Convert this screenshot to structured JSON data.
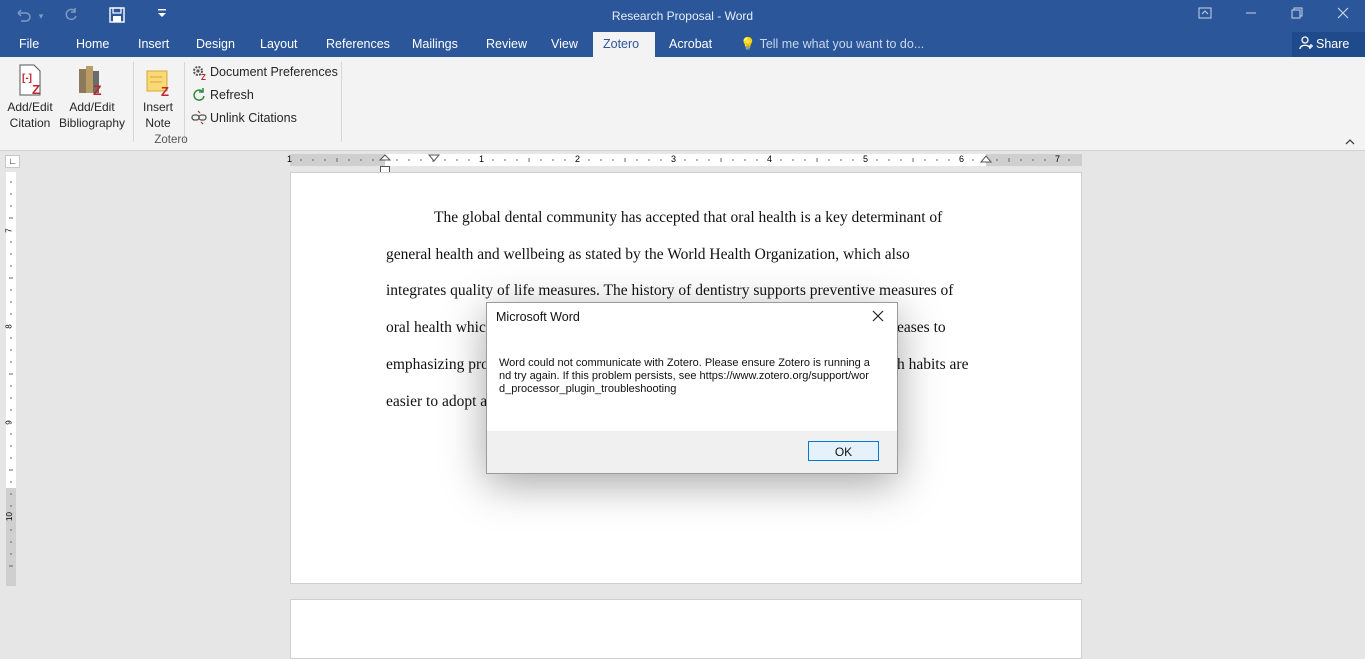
{
  "window": {
    "title": "Research Proposal - Word",
    "qat": {
      "undo_icon": "undo-icon",
      "redo_icon": "redo-icon",
      "save_icon": "save-icon",
      "customize_icon": "customize-qat-icon"
    },
    "controls": {
      "ribbon_display": "ribbon-display-icon",
      "minimize": "minimize-icon",
      "restore": "restore-icon",
      "close": "close-icon"
    }
  },
  "tabs": [
    {
      "label": "File"
    },
    {
      "label": "Home"
    },
    {
      "label": "Insert"
    },
    {
      "label": "Design"
    },
    {
      "label": "Layout"
    },
    {
      "label": "References"
    },
    {
      "label": "Mailings"
    },
    {
      "label": "Review"
    },
    {
      "label": "View"
    },
    {
      "label": "Zotero",
      "active": true
    },
    {
      "label": "Acrobat"
    }
  ],
  "tell_me": "Tell me what you want to do...",
  "share": "Share",
  "ribbon": {
    "group_label": "Zotero",
    "add_edit_citation": [
      "Add/Edit",
      "Citation"
    ],
    "add_edit_bibliography": [
      "Add/Edit",
      "Bibliography"
    ],
    "insert_note": [
      "Insert",
      "Note"
    ],
    "document_preferences": "Document Preferences",
    "refresh": "Refresh",
    "unlink_citations": "Unlink Citations"
  },
  "ruler": {
    "h_numbers": [
      "1",
      "1",
      "2",
      "3",
      "4",
      "5",
      "6",
      "7"
    ],
    "v_numbers": [
      "7",
      "8",
      "9",
      "10"
    ]
  },
  "document": {
    "lines": [
      "The global dental community has accepted that oral health is a key determinant of",
      "general health and wellbeing as stated by the World Health Organization, which also",
      "integrates quality of life measures. The history of dentistry supports preventive measures of",
      "oral health whic",
      "eases to",
      "emphasizing pro",
      "h habits are",
      "easier to adopt a"
    ]
  },
  "dialog": {
    "title": "Microsoft Word",
    "message": "Word could not communicate with Zotero. Please ensure Zotero is running and try again. If this problem persists, see https://www.zotero.org/support/word_processor_plugin_troubleshooting",
    "ok": "OK"
  }
}
